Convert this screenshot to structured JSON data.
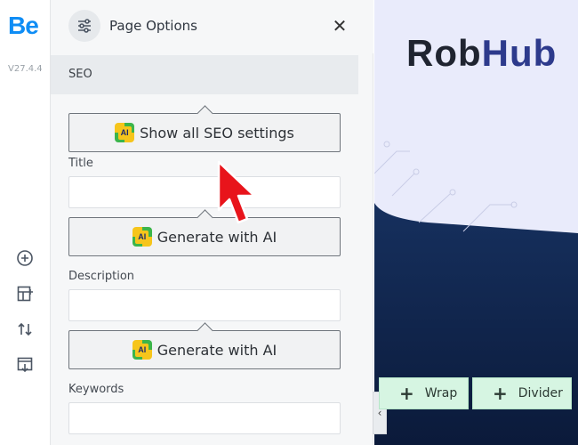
{
  "rail": {
    "logo": "Be",
    "version": "V27.4.4",
    "icons": [
      "add-circle-icon",
      "layout-add-icon",
      "sort-arrows-icon",
      "import-icon"
    ]
  },
  "panel": {
    "title": "Page Options",
    "icon": "sliders-icon",
    "close_icon": "close-icon",
    "section": "SEO",
    "seo_button": "Show all SEO settings",
    "fields": [
      {
        "label": "Title",
        "value": "",
        "ai_button": "Generate with AI"
      },
      {
        "label": "Description",
        "value": "",
        "ai_button": "Generate with AI"
      },
      {
        "label": "Keywords",
        "value": ""
      }
    ]
  },
  "preview": {
    "brand_part1": "Rob",
    "brand_part2": "Hub",
    "collapse_glyph": "‹",
    "add_wrap": "Wrap",
    "add_divider": "Divider",
    "plus": "+"
  },
  "colors": {
    "accent": "#0f8df5",
    "brand_dark": "#1f2430",
    "brand_blue": "#2d3a8c",
    "add_button_bg": "#d6f5e2",
    "cursor": "#e8141b"
  }
}
